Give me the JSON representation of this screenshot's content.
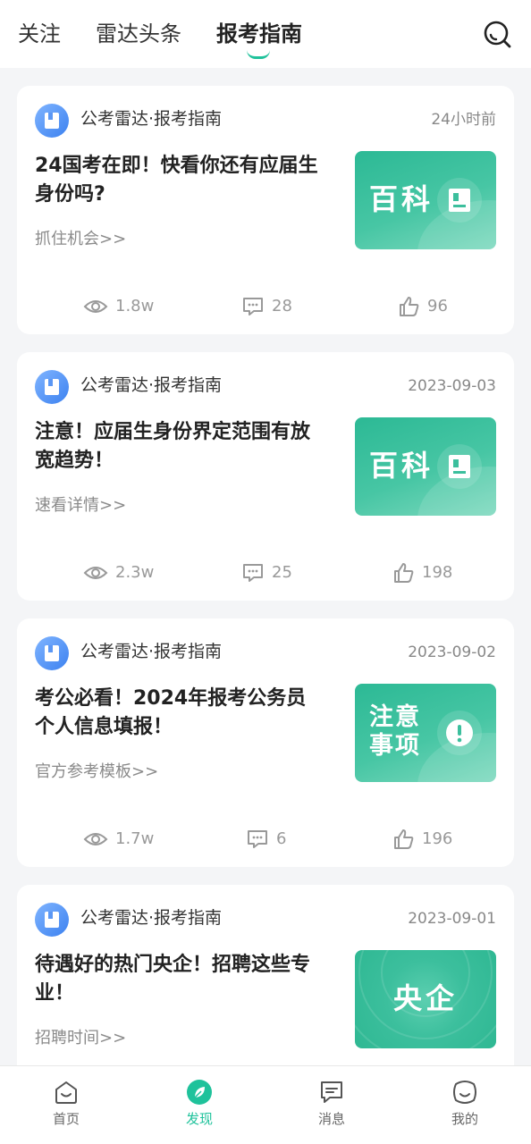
{
  "header": {
    "tabs": [
      {
        "label": "关注"
      },
      {
        "label": "雷达头条"
      },
      {
        "label": "报考指南"
      }
    ]
  },
  "colors": {
    "accent": "#1fc29b",
    "thumb": "#38bf9c",
    "avatar": "#4a8ff2"
  },
  "feed": [
    {
      "source": "公考雷达·报考指南",
      "time": "24小时前",
      "title": "24国考在即！快看你还有应届生身份吗?",
      "subtitle": "抓住机会>>",
      "thumb_text": "百科",
      "thumb_icon": "bookmark-card-icon",
      "views": "1.8w",
      "comments": "28",
      "likes": "96"
    },
    {
      "source": "公考雷达·报考指南",
      "time": "2023-09-03",
      "title": "注意！应届生身份界定范围有放宽趋势！",
      "subtitle": "速看详情>>",
      "thumb_text": "百科",
      "thumb_icon": "bookmark-card-icon",
      "views": "2.3w",
      "comments": "25",
      "likes": "198"
    },
    {
      "source": "公考雷达·报考指南",
      "time": "2023-09-02",
      "title": "考公必看！2024年报考公务员个人信息填报！",
      "subtitle": "官方参考模板>>",
      "thumb_text": "注意事项",
      "thumb_icon": "exclamation-icon",
      "views": "1.7w",
      "comments": "6",
      "likes": "196"
    },
    {
      "source": "公考雷达·报考指南",
      "time": "2023-09-01",
      "title": "待遇好的热门央企！招聘这些专业！",
      "subtitle": "招聘时间>>",
      "thumb_text": "央企"
    }
  ],
  "bottom_nav": [
    {
      "label": "首页",
      "icon": "home-face-icon"
    },
    {
      "label": "发现",
      "icon": "discover-leaf-icon"
    },
    {
      "label": "消息",
      "icon": "message-icon"
    },
    {
      "label": "我的",
      "icon": "profile-face-icon"
    }
  ]
}
